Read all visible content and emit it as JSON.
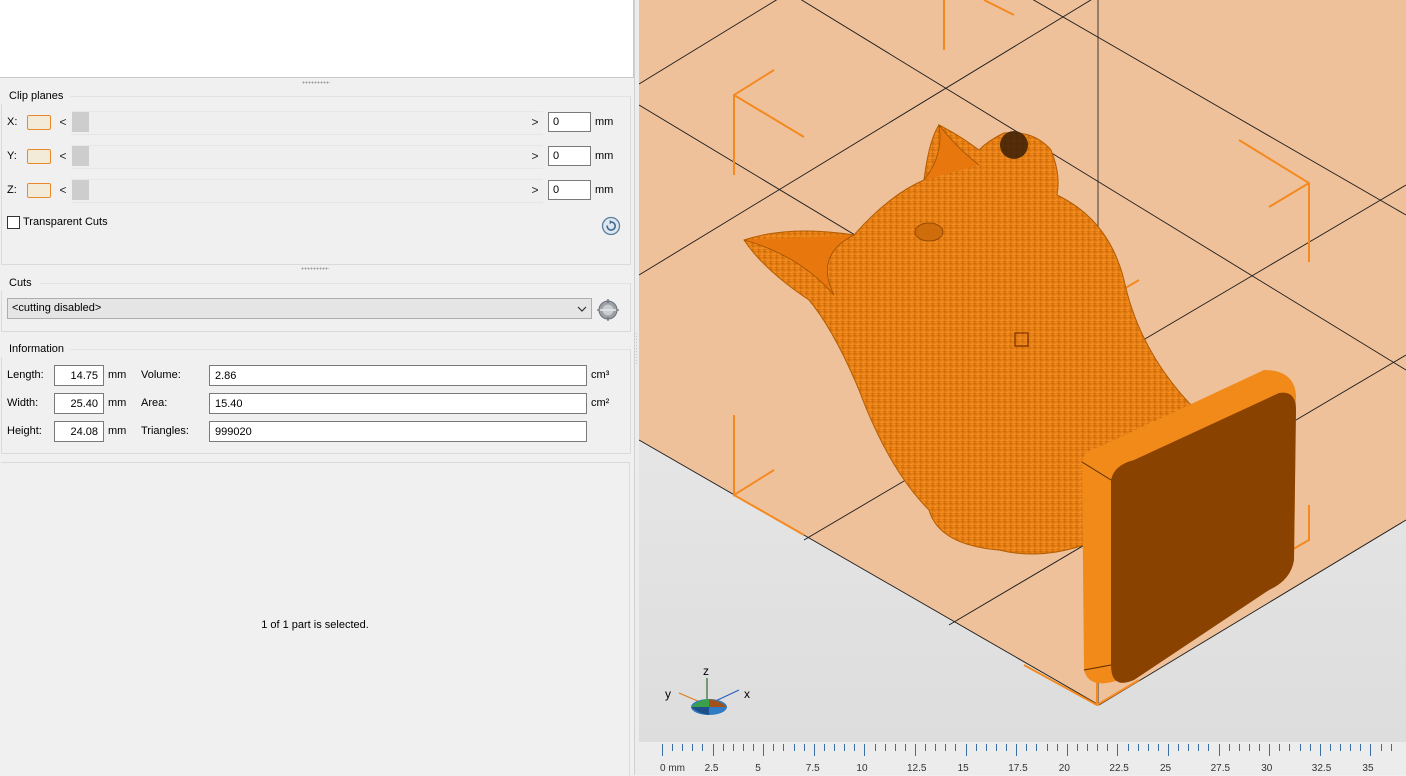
{
  "clip_planes": {
    "title": "Clip planes",
    "axes": [
      {
        "label": "X:",
        "value": "0",
        "unit": "mm"
      },
      {
        "label": "Y:",
        "value": "0",
        "unit": "mm"
      },
      {
        "label": "Z:",
        "value": "0",
        "unit": "mm"
      }
    ],
    "left_arrow": "<",
    "right_arrow": ">",
    "transparent_cuts_label": "Transparent Cuts",
    "transparent_cuts_checked": false
  },
  "cuts": {
    "title": "Cuts",
    "selected": "<cutting disabled>"
  },
  "information": {
    "title": "Information",
    "length_label": "Length:",
    "length_value": "14.75",
    "length_unit": "mm",
    "width_label": "Width:",
    "width_value": "25.40",
    "width_unit": "mm",
    "height_label": "Height:",
    "height_value": "24.08",
    "height_unit": "mm",
    "volume_label": "Volume:",
    "volume_value": "2.86",
    "volume_unit": "cm³",
    "area_label": "Area:",
    "area_value": "15.40",
    "area_unit": "cm²",
    "triangles_label": "Triangles:",
    "triangles_value": "999020"
  },
  "status": {
    "selection_text": "1 of 1 part is selected."
  },
  "viewport": {
    "axis_labels": {
      "z": "z",
      "y": "y",
      "x": "x"
    },
    "ruler_labels": [
      "0 mm",
      "2.5",
      "5",
      "7.5",
      "10",
      "12.5",
      "15",
      "17.5",
      "20",
      "22.5",
      "25",
      "27.5",
      "30",
      "32.5",
      "35"
    ],
    "colors": {
      "model": "#f28a1a",
      "bed": "#eec19b",
      "bounding_box": "#f48a1f",
      "background": "#e8e8e8"
    }
  }
}
